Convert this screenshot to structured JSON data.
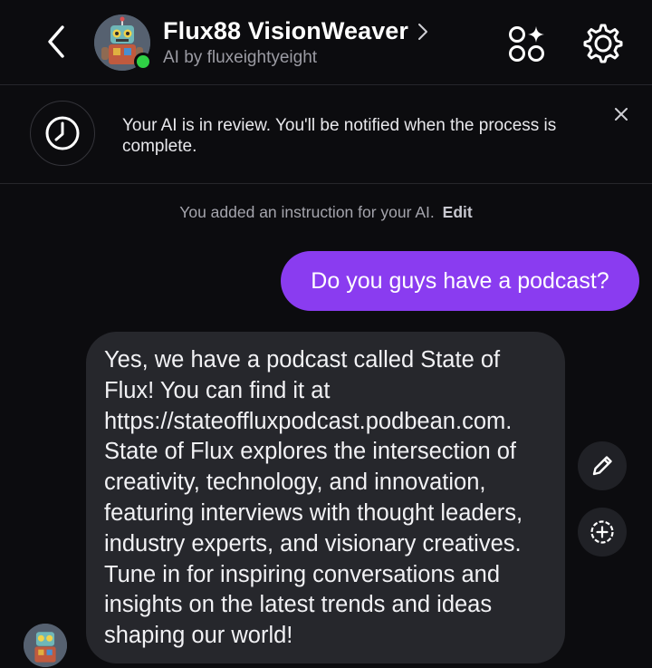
{
  "header": {
    "title": "Flux88 VisionWeaver",
    "subtitle": "AI by fluxeightyeight",
    "icons": {
      "back": "chevron-left-icon",
      "title_chevron": "chevron-right-icon",
      "apps": "apps-sparkle-icon",
      "settings": "gear-icon"
    },
    "online_status_color": "#2fd045"
  },
  "banner": {
    "text": "Your AI is in review. You'll be notified when the process is complete.",
    "icon": "clock-icon",
    "close_icon": "close-icon"
  },
  "instruction": {
    "text": "You added an instruction for your AI.",
    "edit_label": "Edit"
  },
  "messages": [
    {
      "sender": "user",
      "text": "Do you guys have a podcast?",
      "bubble_color": "#8a3cf0"
    },
    {
      "sender": "ai",
      "text": "Yes, we have a podcast called State of Flux! You can find it at https://stateoffluxpodcast.podbean.com. State of Flux explores the intersection of creativity, technology, and innovation, featuring interviews with thought leaders, industry experts, and visionary creatives. Tune in for inspiring conversations and insights on the latest trends and ideas shaping our world!",
      "bubble_color": "#26272c"
    }
  ],
  "message_actions": {
    "edit_icon": "pencil-icon",
    "add_icon": "add-circle-icon"
  }
}
